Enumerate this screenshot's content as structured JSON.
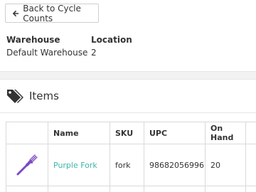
{
  "back_button": {
    "label": "Back to Cycle Counts",
    "icon": "arrow-left-icon"
  },
  "details": {
    "warehouse_label": "Warehouse",
    "warehouse_value": "Default Warehouse",
    "location_label": "Location",
    "location_value": "2"
  },
  "items_section": {
    "title": "Items",
    "icon": "tags-icon"
  },
  "table": {
    "columns": [
      "",
      "Name",
      "SKU",
      "UPC",
      "On Hand",
      ""
    ],
    "rows": [
      {
        "image": "purple-fork-image",
        "name": "Purple Fork",
        "sku": "fork",
        "upc": "98682056996",
        "on_hand": "20"
      }
    ]
  },
  "colors": {
    "link": "#3bb6a6",
    "fork": "#7b4cc4",
    "border": "#d9d9d9",
    "band": "#f2f2f2"
  }
}
